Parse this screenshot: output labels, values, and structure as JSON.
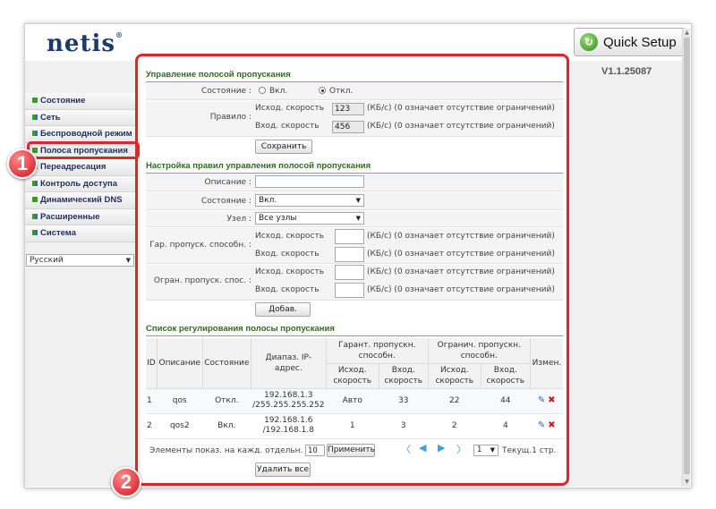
{
  "brand": {
    "logo": "netis",
    "quick_setup": "Quick Setup",
    "version": "V1.1.25087"
  },
  "menu": [
    {
      "label": "Состояние",
      "icon": "green-square-icon"
    },
    {
      "label": "Сеть",
      "icon": "grid-icon"
    },
    {
      "label": "Беспроводной режим",
      "icon": "grid-icon"
    },
    {
      "label": "Полоса пропускания",
      "icon": "green-square-icon",
      "active": true
    },
    {
      "label": "Переадресация",
      "icon": "grid-icon"
    },
    {
      "label": "Контроль доступа",
      "icon": "grid-icon"
    },
    {
      "label": "Динамический DNS",
      "icon": "green-square-icon"
    },
    {
      "label": "Расширенные",
      "icon": "grid-icon"
    },
    {
      "label": "Система",
      "icon": "grid-icon"
    }
  ],
  "language": "Русский",
  "bw_control": {
    "title": "Управление полосой пропускания",
    "state_label": "Состояние :",
    "on": "Вкл.",
    "off": "Откл.",
    "rule_label": "Правило :",
    "up_label": "Исход. скорость",
    "down_label": "Вход. скорость",
    "up_value": "123",
    "down_value": "456",
    "hint": "(КБ/с) (0 означает отсутствие ограничений)",
    "save": "Сохранить"
  },
  "rules": {
    "title": "Настройка правил управления полосой пропускания",
    "desc_label": "Описание :",
    "state_label": "Состояние :",
    "state_value": "Вкл.",
    "node_label": "Узел :",
    "node_value": "Все узлы",
    "guar_label": "Гар. пропуск. способн. :",
    "limit_label": "Огран. пропуск. спос. :",
    "up_label": "Исход. скорость",
    "down_label": "Вход. скорость",
    "hint": "(КБ/с) (0 означает отсутствие ограничений)",
    "add": "Добав."
  },
  "list": {
    "title": "Список регулирования полосы пропускания",
    "headers": {
      "id": "ID",
      "desc": "Описание",
      "state": "Состояние",
      "ip": "Диапаз. IP-адрес.",
      "guar": "Гарант. пропускн. способн.",
      "limit": "Огранич. пропускн. способн.",
      "edit": "Измен.",
      "up": "Исход. скорость",
      "down": "Вход. скорость"
    },
    "rows": [
      {
        "id": "1",
        "desc": "qos",
        "state": "Откл.",
        "ip": "192.168.1.3 /255.255.255.252",
        "g_up": "Авто",
        "g_down": "33",
        "l_up": "22",
        "l_down": "44"
      },
      {
        "id": "2",
        "desc": "qos2",
        "state": "Вкл.",
        "ip": "192.168.1.6 /192.168.1.8",
        "g_up": "1",
        "g_down": "3",
        "l_up": "2",
        "l_down": "4"
      }
    ],
    "per_page_label": "Элементы показ. на кажд. отдельн. стр.",
    "per_page": "10",
    "apply": "Применить",
    "page_select": "1",
    "current": "Текущ.1 стр.",
    "delete_all": "Удалить все"
  },
  "annotations": {
    "one": "1",
    "two": "2"
  },
  "colors": {
    "accent_red": "#e0262c",
    "section_green": "#2c6e1c",
    "menu_text": "#1f2f5a"
  }
}
